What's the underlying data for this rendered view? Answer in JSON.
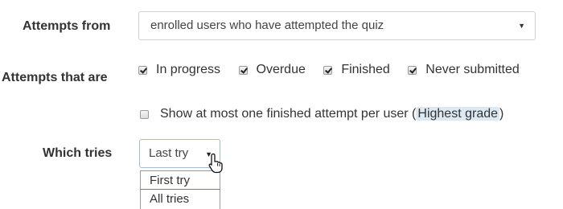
{
  "attempts_from": {
    "label": "Attempts from",
    "selected": "enrolled users who have attempted the quiz",
    "arrow": "▼"
  },
  "attempts_that_are": {
    "label": "Attempts that are",
    "options": [
      {
        "label": "In progress",
        "checked": true
      },
      {
        "label": "Overdue",
        "checked": true
      },
      {
        "label": "Finished",
        "checked": true
      },
      {
        "label": "Never submitted",
        "checked": true
      }
    ]
  },
  "only_one_finished": {
    "label_prefix": "Show at most one finished attempt per user (",
    "label_highlight": "Highest grade",
    "label_suffix": ")",
    "checked": false
  },
  "which_tries": {
    "label": "Which tries",
    "selected": "Last try",
    "arrow": "▼",
    "dropdown_options": [
      "First try",
      "All tries"
    ]
  },
  "icons": {
    "cursor": "hand-pointer-icon"
  }
}
